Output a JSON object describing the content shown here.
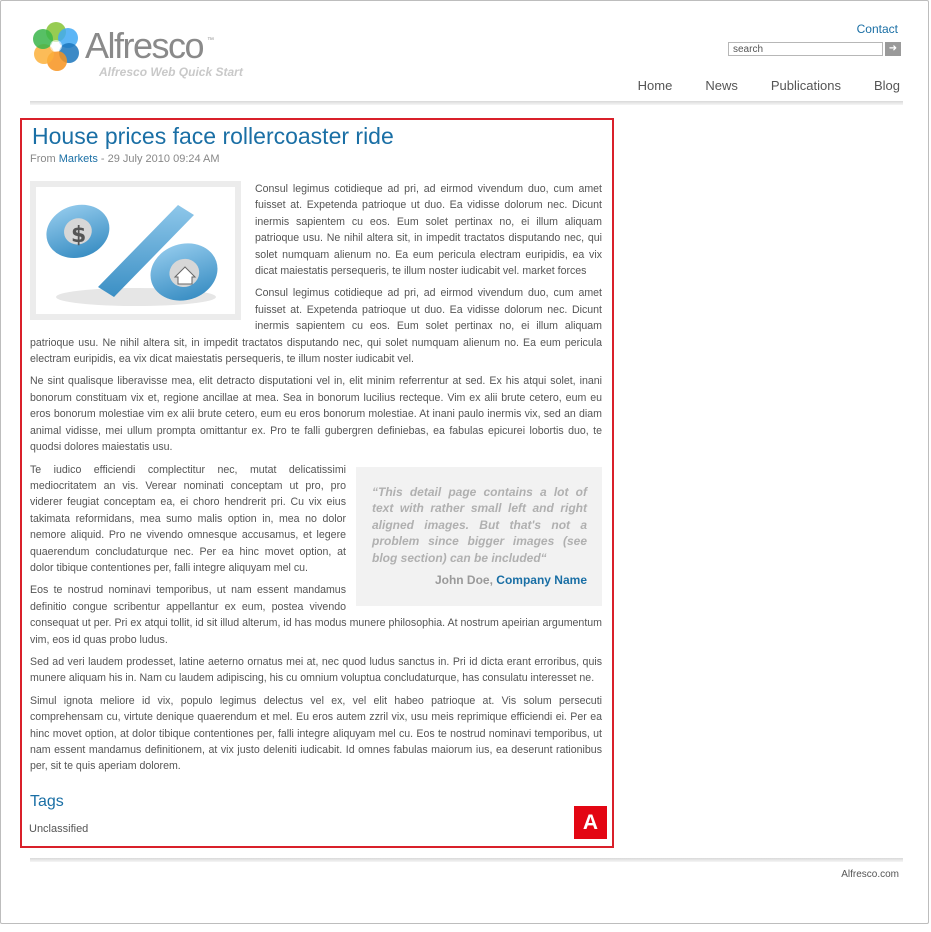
{
  "header": {
    "logo_text": "Alfresco",
    "logo_trademark": "™",
    "tagline": "Alfresco Web Quick Start",
    "contact_label": "Contact",
    "search_placeholder": "search",
    "search_button_glyph": "➜",
    "nav": [
      "Home",
      "News",
      "Publications",
      "Blog"
    ]
  },
  "article": {
    "title": "House prices face rollercoaster ride",
    "byline_prefix": "From",
    "section": "Markets",
    "date": "- 29 July 2010 09:24 AM",
    "image_icon": "dollar-percent-house-icon",
    "paragraphs": [
      "Consul legimus cotidieque ad pri, ad eirmod vivendum duo, cum amet fuisset at. Expetenda patrioque ut duo. Ea vidisse dolorum nec. Dicunt inermis sapientem cu eos. Eum solet pertinax no, ei illum aliquam patrioque usu. Ne nihil altera sit, in impedit tractatos disputando nec, qui solet numquam alienum no. Ea eum pericula electram euripidis, ea vix dicat maiestatis persequeris, te illum noster iudicabit vel. market forces",
      "Consul legimus cotidieque ad pri, ad eirmod vivendum duo, cum amet fuisset at. Expetenda patrioque ut duo. Ea vidisse dolorum nec. Dicunt inermis sapientem cu eos. Eum solet pertinax no, ei illum aliquam patrioque usu. Ne nihil altera sit, in impedit tractatos disputando nec, qui solet numquam alienum no. Ea eum pericula electram euripidis, ea vix dicat maiestatis persequeris, te illum noster iudicabit vel.",
      "Ne sint qualisque liberavisse mea, elit detracto disputationi vel in, elit minim referrentur at sed. Ex his atqui solet, inani bonorum constituam vix et, regione ancillae at mea. Sea in bonorum lucilius recteque. Vim ex alii brute cetero, eum eu eros bonorum molestiae vim ex alii brute cetero, eum eu eros bonorum molestiae. At inani paulo inermis vix, sed an diam animal vidisse, mei ullum prompta omittantur ex. Pro te falli gubergren definiebas, ea fabulas epicurei lobortis duo, te quodsi dolores maiestatis usu.",
      "Te iudico efficiendi complectitur nec, mutat delicatissimi mediocritatem an vis. Verear nominati conceptam ut pro, pro viderer feugiat conceptam ea, ei choro hendrerit pri. Cu vix eius takimata reformidans, mea sumo malis option in, mea no dolor nemore aliquid. Pro ne vivendo omnesque accusamus, et legere quaerendum concludaturque nec. Per ea hinc movet option, at dolor tibique contentiones per, falli integre aliquyam mel cu.",
      "Eos te nostrud nominavi temporibus, ut nam essent mandamus definitio congue scribentur appellantur ex eum, postea vivendo consequat ut per. Pri ex atqui tollit, id sit illud alterum, id has modus munere philosophia. At nostrum apeirian argumentum vim, eos id quas probo ludus.",
      "Sed ad veri laudem prodesset, latine aeterno ornatus mei at, nec quod ludus sanctus in. Pri id dicta erant erroribus, quis munere aliquam his in. Nam cu laudem adipiscing, his cu omnium voluptua concludaturque, has consulatu interesset ne.",
      "Simul ignota meliore id vix, populo legimus delectus vel ex, vel elit habeo patrioque at. Vis solum persecuti comprehensam cu, virtute denique quaerendum et mel. Eu eros autem zzril vix, usu meis reprimique efficiendi ei. Per ea hinc movet option, at dolor tibique contentiones per, falli integre aliquyam mel cu. Eos te nostrud nominavi temporibus, ut nam essent mandamus definitionem, at vix justo deleniti iudicabit. Id omnes fabulas maiorum ius, ea deserunt rationibus per, sit te quis aperiam dolorem."
    ],
    "quote": {
      "text": "“This detail page contains a lot of text with rather small left and right aligned images. But that's not a problem since bigger images (see blog section) can be included“",
      "author": "John Doe,",
      "company": "Company Name"
    },
    "tags_heading": "Tags",
    "tags": [
      "Unclassified"
    ],
    "annotation_badge": "A"
  },
  "footer": {
    "text": "Alfresco.com"
  },
  "colors": {
    "link": "#1a6fa5",
    "annotation": "#e30613",
    "badge": "#e30613"
  }
}
